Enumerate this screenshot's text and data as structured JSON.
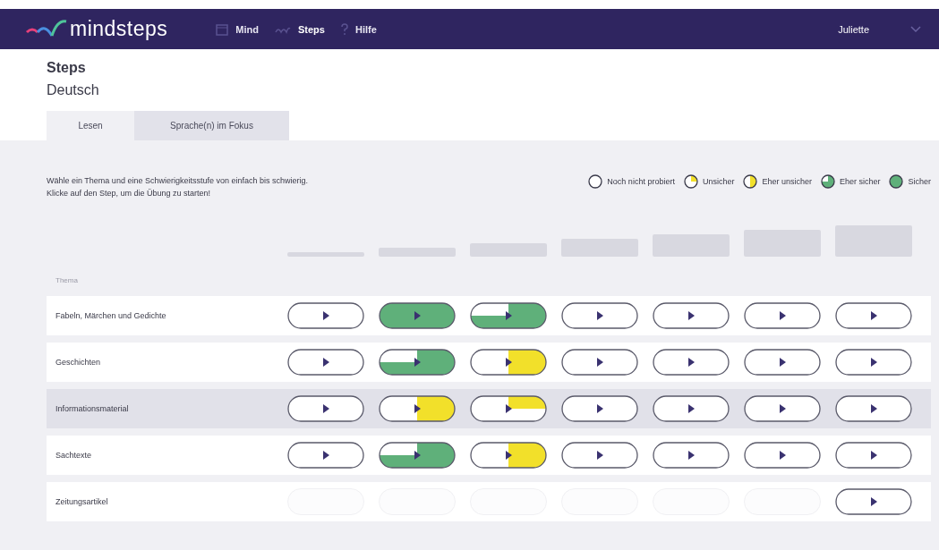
{
  "nav": {
    "logo": "mindsteps",
    "items": [
      {
        "label": "Mind",
        "selected": false
      },
      {
        "label": "Steps",
        "selected": true
      },
      {
        "label": "Hilfe",
        "selected": false
      }
    ],
    "user": "Juliette"
  },
  "header": {
    "title": "Steps",
    "subject": "Deutsch"
  },
  "tabs": [
    {
      "label": "Lesen",
      "selected": true
    },
    {
      "label": "Sprache(n) im Fokus",
      "selected": false
    }
  ],
  "instructions": [
    "Wähle ein Thema und eine Schwierigkeitsstufe von einfach bis schwierig.",
    "Klicke auf den Step, um die Übung zu starten!"
  ],
  "legend": [
    {
      "label": "Noch nicht probiert",
      "kind": "none"
    },
    {
      "label": "Unsicher",
      "kind": "unsicher"
    },
    {
      "label": "Eher unsicher",
      "kind": "eher_unsicher"
    },
    {
      "label": "Eher sicher",
      "kind": "eher_sicher"
    },
    {
      "label": "Sicher",
      "kind": "sicher"
    }
  ],
  "column_header": "Thema",
  "rows": [
    {
      "topic": "Fabeln, Märchen und Gedichte",
      "selected": false,
      "steps": [
        {
          "kind": "none"
        },
        {
          "kind": "sicher"
        },
        {
          "kind": "eher_sicher"
        },
        {
          "kind": "none"
        },
        {
          "kind": "none"
        },
        {
          "kind": "none"
        },
        {
          "kind": "none"
        }
      ]
    },
    {
      "topic": "Geschichten",
      "selected": false,
      "steps": [
        {
          "kind": "none"
        },
        {
          "kind": "eher_sicher"
        },
        {
          "kind": "eher_unsicher"
        },
        {
          "kind": "none"
        },
        {
          "kind": "none"
        },
        {
          "kind": "none"
        },
        {
          "kind": "none"
        }
      ]
    },
    {
      "topic": "Informationsmaterial",
      "selected": true,
      "steps": [
        {
          "kind": "none"
        },
        {
          "kind": "eher_unsicher"
        },
        {
          "kind": "unsicher"
        },
        {
          "kind": "none"
        },
        {
          "kind": "none"
        },
        {
          "kind": "none"
        },
        {
          "kind": "none"
        }
      ]
    },
    {
      "topic": "Sachtexte",
      "selected": false,
      "steps": [
        {
          "kind": "none"
        },
        {
          "kind": "eher_sicher"
        },
        {
          "kind": "eher_unsicher"
        },
        {
          "kind": "none"
        },
        {
          "kind": "none"
        },
        {
          "kind": "none"
        },
        {
          "kind": "none"
        }
      ]
    },
    {
      "topic": "Zeitungsartikel",
      "selected": false,
      "steps": [
        {
          "kind": "locked"
        },
        {
          "kind": "locked"
        },
        {
          "kind": "locked"
        },
        {
          "kind": "locked"
        },
        {
          "kind": "locked"
        },
        {
          "kind": "locked"
        },
        {
          "kind": "none"
        }
      ]
    }
  ]
}
